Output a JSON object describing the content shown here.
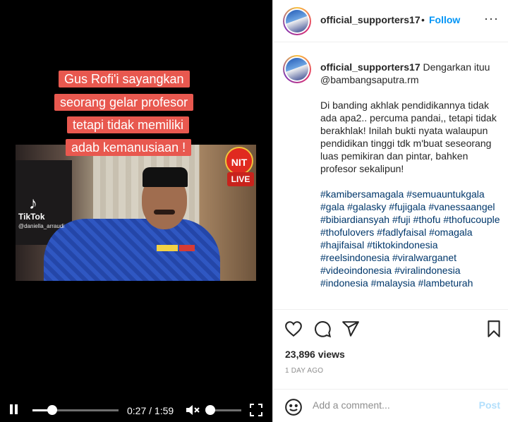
{
  "video": {
    "caption_lines": [
      "Gus Rofi'i sayangkan",
      "seorang gelar profesor",
      "tetapi tidak memiliki",
      "adab kemanusiaan !"
    ],
    "watermark_app": "TikTok",
    "watermark_handle": "@daniella_arraudi",
    "live_badge": "LIVE",
    "nit_logo": "NIT",
    "controls": {
      "time": "0:27 / 1:59",
      "progress": 0.23,
      "volume": 0.0
    }
  },
  "post": {
    "header": {
      "username": "official_supporters17",
      "separator": "•",
      "follow": "Follow",
      "more": "···"
    },
    "caption": {
      "username": "official_supporters17",
      "intro": "Dengarkan ituu @bambangsaputra.rm",
      "body": "Di banding akhlak pendidikannya tidak ada apa2.. percuma pandai,, tetapi tidak berakhlak! Inilah bukti nyata walaupun pendidikan tinggi tdk m'buat seseorang luas pemikiran dan pintar, bahken profesor sekalipun!",
      "hashtags": "#kamibersamagala #semuauntukgala #gala #galasky #fujigala #vanessaangel #bibiardiansyah #fuji #thofu #thofucouple #thofulovers #fadlyfaisal #omagala #hajifaisal #tiktokindonesia #reelsindonesia #viralwarganet #videoindonesia #viralindonesia #indonesia #malaysia #lambeturah"
    },
    "views": "23,896 views",
    "date": "1 DAY AGO",
    "comment": {
      "placeholder": "Add a comment...",
      "post_label": "Post"
    },
    "icons": [
      "heart-icon",
      "comment-icon",
      "share-icon",
      "bookmark-icon",
      "emoji-icon"
    ]
  }
}
